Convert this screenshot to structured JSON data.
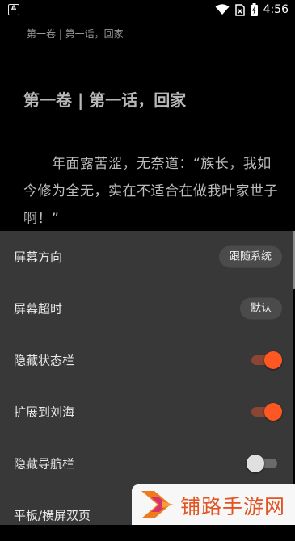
{
  "status_bar": {
    "notification_icon": "A",
    "time": "4:56",
    "icons": [
      "wifi-icon",
      "no-sim-icon",
      "battery-charging-icon"
    ]
  },
  "reader": {
    "header_title": "第一卷 | 第一话，回家",
    "chapter_title": "第一卷 | 第一话，回家",
    "paragraph": "年面露苦涩，无奈道：“族长，我如今修为全无，实在不适合在做我叶家世子啊！”"
  },
  "settings": {
    "screen_orientation": {
      "label": "屏幕方向",
      "value": "跟随系统"
    },
    "screen_timeout": {
      "label": "屏幕超时",
      "value": "默认"
    },
    "hide_status_bar": {
      "label": "隐藏状态栏",
      "enabled": true
    },
    "extend_to_notch": {
      "label": "扩展到刘海",
      "enabled": true
    },
    "hide_nav_bar": {
      "label": "隐藏导航栏",
      "enabled": false
    },
    "tablet_dual_page": {
      "label": "平板/横屏双页"
    }
  },
  "colors": {
    "accent": "#ff5722",
    "panel_bg": "#383838",
    "watermark_orange": "#e05522"
  },
  "watermark": {
    "text": "铺路手游网"
  }
}
